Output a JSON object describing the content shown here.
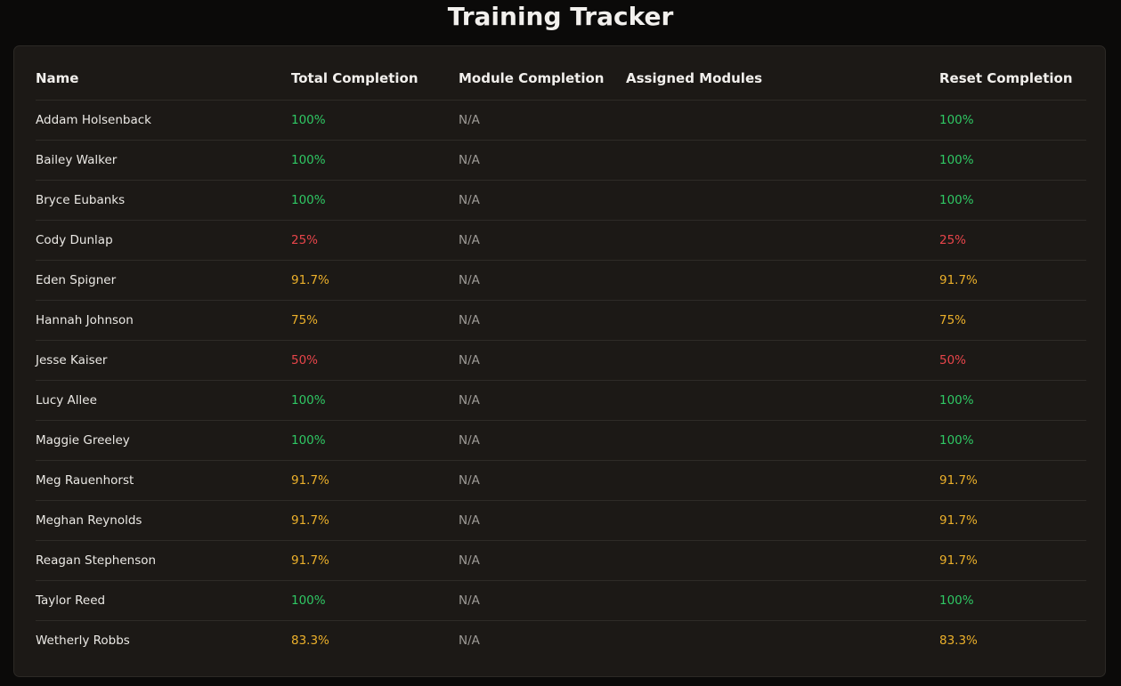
{
  "page": {
    "title": "Training Tracker"
  },
  "table": {
    "columns": [
      "Name",
      "Total Completion",
      "Module Completion",
      "Assigned Modules",
      "Reset Completion"
    ],
    "rows": [
      {
        "name": "Addam Holsenback",
        "total": "100%",
        "module": "N/A",
        "assigned": "",
        "reset": "100%",
        "status": "green"
      },
      {
        "name": "Bailey Walker",
        "total": "100%",
        "module": "N/A",
        "assigned": "",
        "reset": "100%",
        "status": "green"
      },
      {
        "name": "Bryce Eubanks",
        "total": "100%",
        "module": "N/A",
        "assigned": "",
        "reset": "100%",
        "status": "green"
      },
      {
        "name": "Cody Dunlap",
        "total": "25%",
        "module": "N/A",
        "assigned": "",
        "reset": "25%",
        "status": "red"
      },
      {
        "name": "Eden Spigner",
        "total": "91.7%",
        "module": "N/A",
        "assigned": "",
        "reset": "91.7%",
        "status": "amber"
      },
      {
        "name": "Hannah Johnson",
        "total": "75%",
        "module": "N/A",
        "assigned": "",
        "reset": "75%",
        "status": "amber"
      },
      {
        "name": "Jesse Kaiser",
        "total": "50%",
        "module": "N/A",
        "assigned": "",
        "reset": "50%",
        "status": "red"
      },
      {
        "name": "Lucy Allee",
        "total": "100%",
        "module": "N/A",
        "assigned": "",
        "reset": "100%",
        "status": "green"
      },
      {
        "name": "Maggie Greeley",
        "total": "100%",
        "module": "N/A",
        "assigned": "",
        "reset": "100%",
        "status": "green"
      },
      {
        "name": "Meg Rauenhorst",
        "total": "91.7%",
        "module": "N/A",
        "assigned": "",
        "reset": "91.7%",
        "status": "amber"
      },
      {
        "name": "Meghan Reynolds",
        "total": "91.7%",
        "module": "N/A",
        "assigned": "",
        "reset": "91.7%",
        "status": "amber"
      },
      {
        "name": "Reagan Stephenson",
        "total": "91.7%",
        "module": "N/A",
        "assigned": "",
        "reset": "91.7%",
        "status": "amber"
      },
      {
        "name": "Taylor Reed",
        "total": "100%",
        "module": "N/A",
        "assigned": "",
        "reset": "100%",
        "status": "green"
      },
      {
        "name": "Wetherly Robbs",
        "total": "83.3%",
        "module": "N/A",
        "assigned": "",
        "reset": "83.3%",
        "status": "amber"
      }
    ]
  },
  "colors": {
    "background": "#0b0a09",
    "card": "#1c1916",
    "status_green": "#2fc864",
    "status_amber": "#ecb02a",
    "status_red": "#e8454a",
    "na_text": "#9d9a96"
  }
}
